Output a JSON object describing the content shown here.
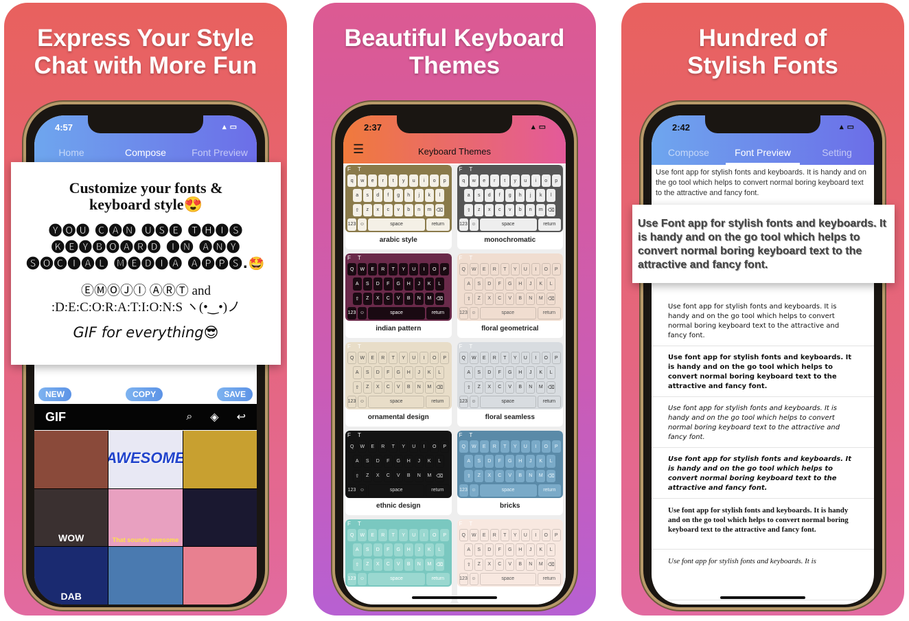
{
  "panels": [
    {
      "headline": "Express Your Style Chat with More Fun",
      "time": "4:57",
      "tabs": [
        "Home",
        "Compose",
        "Font Preview"
      ],
      "active_tab": "Compose",
      "card": {
        "line1": "Customize your fonts & keyboard style😍",
        "line2": "🅨🅞🅤 🅒🅐🅝 🅤🅢🅔 🅣🅗🅘🅢 🅚🅔🅨🅑🅞🅐🅡🅓 🅘🅝 🅐🅝🅨 🅢🅞🅒🅘🅐🅛 🅜🅔🅓🅘🅐 🅐🅟🅟🅢.🤩",
        "line3a": "ⒺⓂⓄⒿⒾ ⒶⓇⓉ and",
        "line3b": ":D:E:C:O:R:A:T:I:O:N:S ヽ(•‿•)ノ",
        "line4": "GIF for everything😎"
      },
      "buttons": {
        "new": "NEW",
        "copy": "COPY",
        "save": "SAVE"
      },
      "gif_bar": {
        "label": "GIF",
        "icons": [
          "search-icon",
          "tag-icon",
          "return-icon"
        ]
      },
      "gifs": [
        {
          "text": "",
          "color": "#8a4a3a"
        },
        {
          "text": "AWESOME",
          "color": "#e8e8f4"
        },
        {
          "text": "",
          "color": "#c8a030"
        },
        {
          "text": "WOW",
          "color": "#3a3030"
        },
        {
          "text": "That sounds awesome",
          "color": "#e8a0c0"
        },
        {
          "text": "",
          "color": "#1a1830"
        },
        {
          "text": "DAB",
          "color": "#1a2a70"
        },
        {
          "text": "",
          "color": "#4a7ab0"
        },
        {
          "text": "",
          "color": "#e88090"
        }
      ]
    },
    {
      "headline": "Beautiful Keyboard Themes",
      "time": "2:37",
      "nav_title": "Keyboard Themes",
      "themes": [
        {
          "name": "arabic style",
          "bg": "#8a7a4a",
          "key": "#f4f0e6",
          "fg": "#333",
          "upper": false
        },
        {
          "name": "monochromatic",
          "bg": "#555",
          "key": "#eee",
          "fg": "#333",
          "upper": false
        },
        {
          "name": "indian pattern",
          "bg": "#6a2a4a",
          "key": "#1a0a12",
          "fg": "#fff",
          "upper": true
        },
        {
          "name": "floral geometrical",
          "bg": "#f0ddd0",
          "key": "transparent",
          "fg": "#555",
          "upper": true
        },
        {
          "name": "ornamental design",
          "bg": "#e8ddc8",
          "key": "transparent",
          "fg": "#444",
          "upper": true
        },
        {
          "name": "floral seamless",
          "bg": "#d8dce0",
          "key": "transparent",
          "fg": "#333",
          "upper": true
        },
        {
          "name": "ethnic design",
          "bg": "#141414",
          "key": "transparent",
          "fg": "#ddd",
          "upper": true
        },
        {
          "name": "bricks",
          "bg": "#5a8aa8",
          "key": "#7aaac8",
          "fg": "#e8f4fa",
          "upper": true
        },
        {
          "name": "",
          "bg": "#7ac8c0",
          "key": "#9ad8d0",
          "fg": "#fff",
          "upper": true
        },
        {
          "name": "",
          "bg": "#f8e8e0",
          "key": "transparent",
          "fg": "#555",
          "upper": true
        }
      ],
      "key_rows": [
        "qwertyuiop",
        "asdfghjkl",
        "zxcvbnm"
      ],
      "space": "space",
      "return": "return",
      "num": "123"
    },
    {
      "headline": "Hundred of Stylish Fonts",
      "time": "2:42",
      "tabs": [
        "Compose",
        "Font Preview",
        "Setting"
      ],
      "active_tab": "Font Preview",
      "top_text": "Use font app for stylish fonts and keyboards. It is handy and on the go tool which helps to convert normal boring keyboard text to the attractive and fancy font.",
      "card_text": "Use Font app for stylish fonts and keyboards. It is handy and on the go tool which helps to convert normal boring keyboard text to the attractive and fancy font.",
      "samples": [
        "Use font app for stylish fonts and keyboards. It is handy and on the go tool which helps to convert normal boring keyboard text to the attractive and fancy font.",
        "Use font app for stylish fonts and keyboards. It is handy and on the go tool which helps to convert normal boring keyboard text to the attractive and fancy font.",
        "Use font app for stylish fonts and keyboards. It is handy and on the go tool which helps to convert normal boring keyboard text to the attractive and fancy font.",
        "Use font app for stylish fonts and keyboards. It is handy and on the go tool which helps to convert normal boring keyboard text to the attractive and fancy font.",
        "Use font app for stylish fonts and keyboards. It is handy and on the go tool which helps to convert normal boring keyboard text to the attractive and fancy font.",
        "Use font app for stylish fonts and keyboards. It is"
      ]
    }
  ]
}
